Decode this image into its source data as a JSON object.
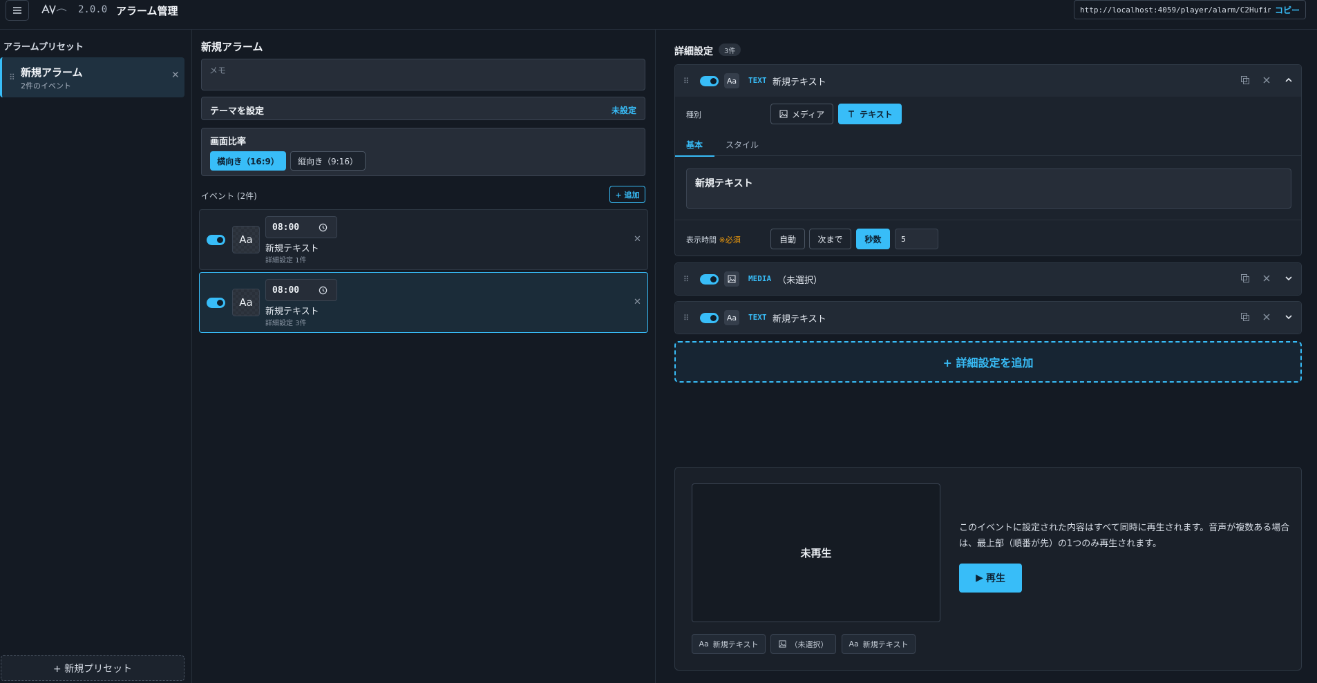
{
  "header": {
    "version": "2.0.0",
    "title": "アラーム管理",
    "url": "http://localhost:4059/player/alarm/C2Hufina4g",
    "copy_label": "コピー"
  },
  "sidebar": {
    "title": "アラームプリセット",
    "presets": [
      {
        "name": "新規アラーム",
        "sub": "2件のイベント"
      }
    ],
    "new_preset_label": "+ 新規プリセット"
  },
  "middle": {
    "title": "新規アラーム",
    "memo_placeholder": "メモ",
    "theme_label": "テーマを設定",
    "theme_value": "未設定",
    "ratio_label": "画面比率",
    "ratio_options": [
      "横向き（16:9）",
      "縦向き（9:16）"
    ],
    "events_label": "イベント (2件)",
    "add_label": "+ 追加",
    "events": [
      {
        "time": "08:00",
        "thumb": "Aa",
        "title": "新規テキスト",
        "sub": "詳細設定 1件"
      },
      {
        "time": "08:00",
        "thumb": "Aa",
        "title": "新規テキスト",
        "sub": "詳細設定 3件"
      }
    ]
  },
  "detail": {
    "title": "詳細設定",
    "count": "3件",
    "items": [
      {
        "chip": "Aa",
        "type": "TEXT",
        "name": "新規テキスト"
      },
      {
        "chip": "media-icon",
        "type": "MEDIA",
        "name": "（未選択）"
      },
      {
        "chip": "Aa",
        "type": "TEXT",
        "name": "新規テキスト"
      }
    ],
    "kind_label": "種別",
    "kind_media": "メディア",
    "kind_text": "テキスト",
    "tab_basic": "基本",
    "tab_style": "スタイル",
    "text_value": "新規テキスト",
    "duration_label": "表示時間",
    "required_label": "※必須",
    "duration_options": [
      "自動",
      "次まで",
      "秒数"
    ],
    "duration_value": "5",
    "add_detail_label": "+ 詳細設定を追加"
  },
  "preview": {
    "status": "未再生",
    "description": "このイベントに設定された内容はすべて同時に再生されます。音声が複数ある場合は、最上部（順番が先）の1つのみ再生されます。",
    "play_label": "再生",
    "layers": [
      {
        "icon": "Aa",
        "label": "新規テキスト"
      },
      {
        "icon": "media-icon",
        "label": "（未選択）"
      },
      {
        "icon": "Aa",
        "label": "新規テキスト"
      }
    ]
  },
  "colors": {
    "accent": "#38bdf8",
    "background": "#141a23",
    "panel": "#1c232d"
  }
}
